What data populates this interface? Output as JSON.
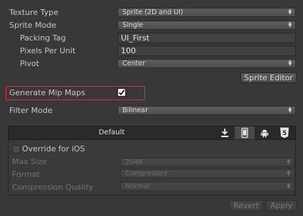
{
  "texture_type": {
    "label": "Texture Type",
    "value": "Sprite (2D and UI)"
  },
  "sprite_mode": {
    "label": "Sprite Mode",
    "value": "Single"
  },
  "packing_tag": {
    "label": "Packing Tag",
    "value": "UI_First"
  },
  "pixels_per_unit": {
    "label": "Pixels Per Unit",
    "value": "100"
  },
  "pivot": {
    "label": "Pivot",
    "value": "Center"
  },
  "sprite_editor_button": "Sprite Editor",
  "generate_mip_maps": {
    "label": "Generate Mip Maps",
    "checked": true
  },
  "filter_mode": {
    "label": "Filter Mode",
    "value": "Bilinear"
  },
  "platform_tabs": {
    "active": "Default",
    "icons": [
      "download-icon",
      "mobile-device-icon",
      "android-icon",
      "html5-icon"
    ],
    "html5_glyph": "5"
  },
  "override": {
    "label": "Override for iOS",
    "checked": false
  },
  "max_size": {
    "label": "Max Size",
    "value": "2048"
  },
  "format": {
    "label": "Format",
    "value": "Compressed"
  },
  "compression_quality": {
    "label": "Compression Quality",
    "value": "Normal"
  },
  "footer": {
    "revert": "Revert",
    "apply": "Apply"
  },
  "colors": {
    "background": "#383838",
    "highlight_border": "#d8303a"
  }
}
